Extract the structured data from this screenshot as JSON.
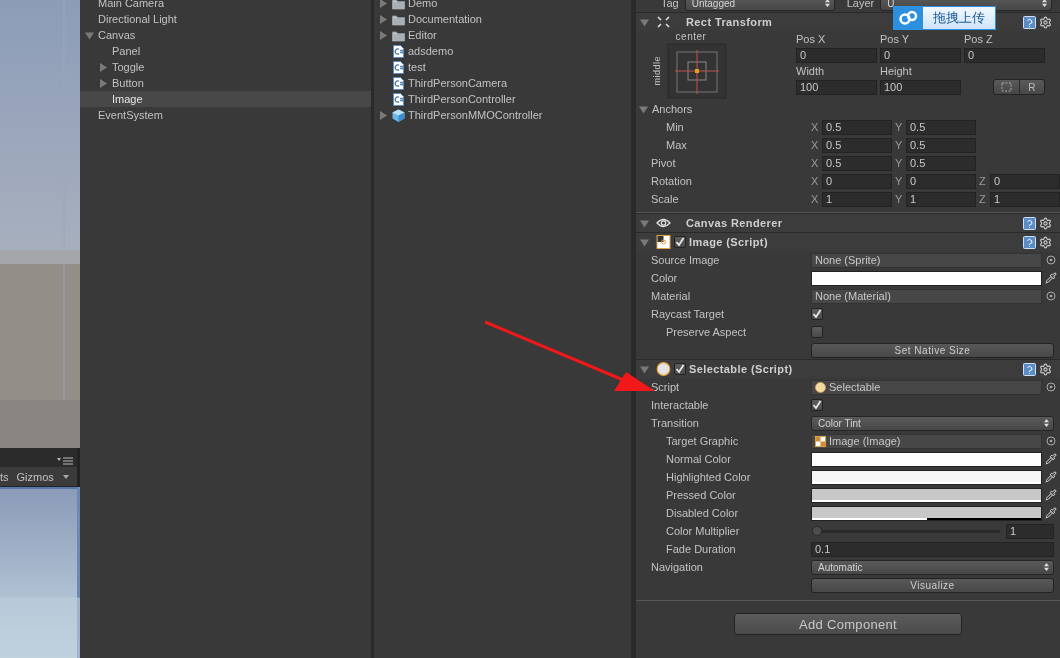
{
  "scene_view": {
    "toolbar": [
      {
        "label": "ts"
      },
      {
        "label": "Gizmos"
      }
    ]
  },
  "hierarchy": {
    "items": [
      {
        "label": "Main Camera",
        "has_children": false,
        "selected": false
      },
      {
        "label": "Directional Light",
        "has_children": false,
        "selected": false
      },
      {
        "label": "Canvas",
        "has_children": true,
        "expanded": true,
        "selected": false,
        "children": [
          {
            "label": "Panel",
            "has_children": false,
            "selected": false
          },
          {
            "label": "Toggle",
            "has_children": true,
            "expanded": false,
            "selected": false
          },
          {
            "label": "Button",
            "has_children": true,
            "expanded": false,
            "selected": false
          },
          {
            "label": "Image",
            "has_children": false,
            "selected": true
          }
        ]
      },
      {
        "label": "EventSystem",
        "has_children": false,
        "selected": false
      }
    ]
  },
  "project": {
    "items": [
      {
        "label": "Demo",
        "kind": "folder",
        "has_children": true
      },
      {
        "label": "Documentation",
        "kind": "folder",
        "has_children": true
      },
      {
        "label": "Editor",
        "kind": "folder",
        "has_children": true
      },
      {
        "label": "adsdemo",
        "kind": "script",
        "has_children": false
      },
      {
        "label": "test",
        "kind": "script",
        "has_children": false
      },
      {
        "label": "ThirdPersonCamera",
        "kind": "script",
        "has_children": false
      },
      {
        "label": "ThirdPersonController",
        "kind": "script",
        "has_children": false
      },
      {
        "label": "ThirdPersonMMOController",
        "kind": "prefab",
        "has_children": true
      }
    ]
  },
  "inspector": {
    "tag_row": {
      "tag_label": "Tag",
      "tag_value": "Untagged",
      "layer_label": "Layer",
      "layer_value": "U"
    },
    "components": [
      {
        "kind": "rect_transform",
        "title": "Rect Transform",
        "expanded": true,
        "anchor_preset": {
          "horizontal": "center",
          "vertical": "middle"
        },
        "fields": [
          {
            "label": "Pos X",
            "value": "0"
          },
          {
            "label": "Pos Y",
            "value": "0"
          },
          {
            "label": "Pos Z",
            "value": "0"
          },
          {
            "label": "Width",
            "value": "100"
          },
          {
            "label": "Height",
            "value": "100"
          }
        ],
        "reset_button": "R",
        "anchors": {
          "label": "Anchors",
          "expanded": true,
          "rows": [
            {
              "label": "Min",
              "axes": [
                {
                  "axis": "X",
                  "value": "0.5"
                },
                {
                  "axis": "Y",
                  "value": "0.5"
                }
              ]
            },
            {
              "label": "Max",
              "axes": [
                {
                  "axis": "X",
                  "value": "0.5"
                },
                {
                  "axis": "Y",
                  "value": "0.5"
                }
              ]
            }
          ]
        },
        "rows": [
          {
            "label": "Pivot",
            "axes": [
              {
                "axis": "X",
                "value": "0.5"
              },
              {
                "axis": "Y",
                "value": "0.5"
              }
            ]
          },
          {
            "label": "Rotation",
            "axes": [
              {
                "axis": "X",
                "value": "0"
              },
              {
                "axis": "Y",
                "value": "0"
              },
              {
                "axis": "Z",
                "value": "0"
              }
            ]
          },
          {
            "label": "Scale",
            "axes": [
              {
                "axis": "X",
                "value": "1"
              },
              {
                "axis": "Y",
                "value": "1"
              },
              {
                "axis": "Z",
                "value": "1"
              }
            ]
          }
        ]
      },
      {
        "kind": "renderer",
        "title": "Canvas Renderer",
        "expanded": true
      },
      {
        "kind": "image_script",
        "title": "Image (Script)",
        "enabled": true,
        "expanded": true,
        "properties": [
          {
            "kind": "object",
            "label": "Source Image",
            "value": "None (Sprite)",
            "indented": false
          },
          {
            "kind": "color",
            "label": "Color",
            "color": "#ffffff",
            "level": 1,
            "indented": false
          },
          {
            "kind": "object",
            "label": "Material",
            "value": "None (Material)",
            "indented": false
          },
          {
            "kind": "checkbox",
            "label": "Raycast Target",
            "checked": true,
            "indented": false
          },
          {
            "kind": "checkbox",
            "label": "Preserve Aspect",
            "checked": false,
            "indented": true
          },
          {
            "kind": "button",
            "value": "Set Native Size"
          }
        ]
      },
      {
        "kind": "script",
        "title": "Selectable (Script)",
        "enabled": true,
        "expanded": true,
        "properties": [
          {
            "kind": "script_object",
            "label": "Script",
            "value": "Selectable",
            "indented": false
          },
          {
            "kind": "checkbox",
            "label": "Interactable",
            "checked": true,
            "indented": false
          },
          {
            "kind": "dropdown",
            "label": "Transition",
            "value": "Color Tint",
            "indented": false
          },
          {
            "kind": "image_object",
            "label": "Target Graphic",
            "value": "Image (Image)",
            "indented": true
          },
          {
            "kind": "color",
            "label": "Normal Color",
            "color": "#ffffff",
            "level": 1,
            "indented": true
          },
          {
            "kind": "color",
            "label": "Highlighted Color",
            "color": "#f5f5f5",
            "level": 1,
            "indented": true
          },
          {
            "kind": "color",
            "label": "Pressed Color",
            "color": "#c8c8c8",
            "level": 1,
            "indented": true
          },
          {
            "kind": "color",
            "label": "Disabled Color",
            "color": "#c8c8c8",
            "level": 0.5,
            "indented": true
          },
          {
            "kind": "slider",
            "label": "Color Multiplier",
            "value": "1",
            "level": 0,
            "indented": true
          },
          {
            "kind": "text",
            "label": "Fade Duration",
            "value": "0.1",
            "indented": true
          },
          {
            "kind": "dropdown",
            "label": "Navigation",
            "value": "Automatic",
            "indented": false
          },
          {
            "kind": "button",
            "value": "Visualize"
          }
        ]
      }
    ],
    "add_button": "Add Component"
  },
  "upload_widget": {
    "label": "拖拽上传"
  }
}
